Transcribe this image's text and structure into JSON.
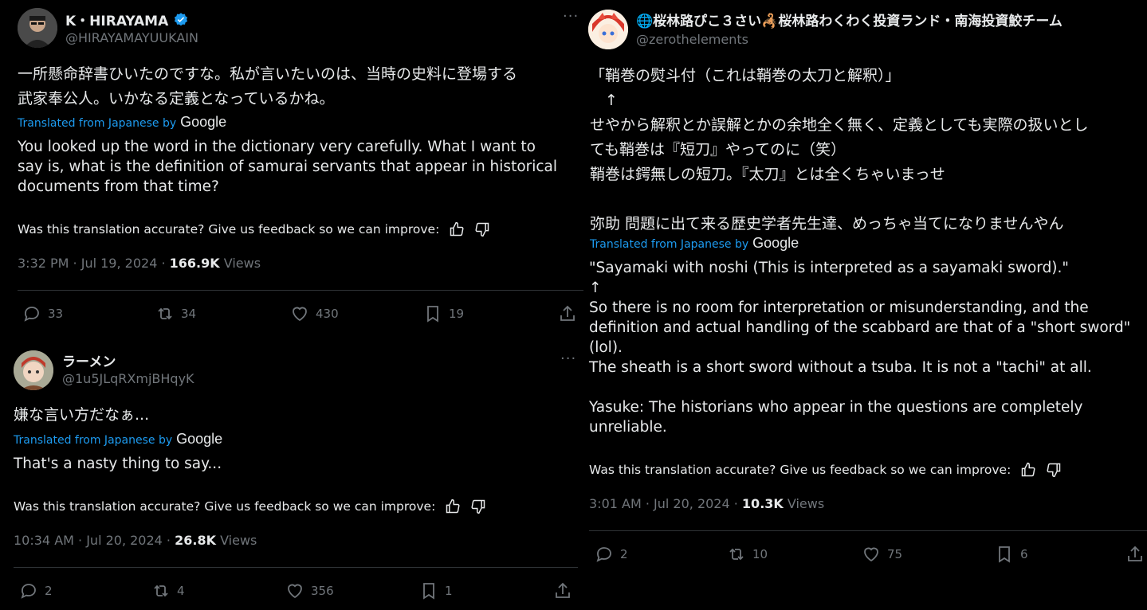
{
  "tweet1": {
    "name": "K・HIRAYAMA",
    "handle": "@HIRAYAMAYUUKAIN",
    "more": "···",
    "jp_lines": [
      "一所懸命辞書ひいたのですな。私が言いたいのは、当時の史料に登場する",
      "武家奉公人。いかなる定義となっているかね。"
    ],
    "translated_label": "Translated from Japanese by",
    "google": "Google",
    "en_lines": [
      "You looked up the word in the dictionary very carefully. What I want to",
      "say is, what is the definition of samurai servants that appear in historical",
      "documents from that time?"
    ],
    "feedback": "Was this translation accurate? Give us feedback so we can improve:",
    "time": "3:32 PM · Jul 19, 2024 · ",
    "views_count": "166.9K",
    "views_label": " Views",
    "replies": "33",
    "reposts": "34",
    "likes": "430",
    "bookmarks": "19"
  },
  "tweet2": {
    "name": "ラーメン",
    "handle": "@1u5JLqRXmjBHqyK",
    "more": "···",
    "jp_lines": [
      "嫌な言い方だなぁ..."
    ],
    "translated_label": "Translated from Japanese by",
    "google": "Google",
    "en_lines": [
      "That's a nasty thing to say..."
    ],
    "feedback": "Was this translation accurate? Give us feedback so we can improve:",
    "time": "10:34 AM · Jul 20, 2024 · ",
    "views_count": "26.8K",
    "views_label": " Views",
    "replies": "2",
    "reposts": "4",
    "likes": "356",
    "bookmarks": "1"
  },
  "tweet3": {
    "name": "🌐桜林路ぴこ３さい🦂桜林路わくわく投資ランド・南海投資鮫チーム",
    "handle": "@zerothelements",
    "jp_lines": [
      "「鞘巻の熨斗付（これは鞘巻の太刀と解釈）」",
      "　↑",
      "せやから解釈とか誤解とかの余地全く無く、定義としても実際の扱いとし",
      "ても鞘巻は『短刀』やってのに（笑）",
      "鞘巻は鍔無しの短刀。『太刀』とは全くちゃいまっせ",
      "",
      "弥助 問題に出て来る歴史学者先生達、めっちゃ当てになりませんやん"
    ],
    "translated_label": "Translated from Japanese by",
    "google": "Google",
    "en_lines": [
      "\"Sayamaki with noshi (This is interpreted as a sayamaki sword).\"",
      "↑",
      "So there is no room for interpretation or misunderstanding, and the",
      "definition and actual handling of the scabbard are that of a \"short sword\"",
      "(lol).",
      "The sheath is a short sword without a tsuba. It is not a \"tachi\" at all.",
      "",
      "Yasuke: The historians who appear in the questions are completely",
      "unreliable."
    ],
    "feedback": "Was this translation accurate? Give us feedback so we can improve:",
    "time": "3:01 AM · Jul 20, 2024 · ",
    "views_count": "10.3K",
    "views_label": " Views",
    "replies": "2",
    "reposts": "10",
    "likes": "75",
    "bookmarks": "6"
  },
  "colors": {
    "background": "#000000",
    "text": "#e7e9ea",
    "muted": "#71767b",
    "link": "#1d9bf0",
    "verified": "#1d9bf0",
    "divider": "#2f3336"
  }
}
